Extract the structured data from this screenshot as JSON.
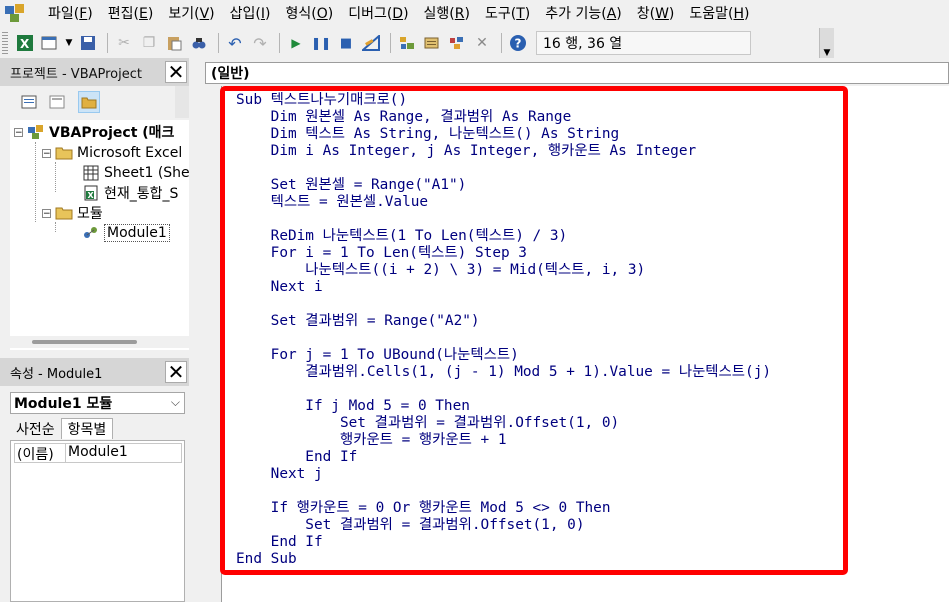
{
  "menu": {
    "items": [
      {
        "label": "파일(F)"
      },
      {
        "label": "편집(E)"
      },
      {
        "label": "보기(V)"
      },
      {
        "label": "삽입(I)"
      },
      {
        "label": "형식(O)"
      },
      {
        "label": "디버그(D)"
      },
      {
        "label": "실행(R)"
      },
      {
        "label": "도구(T)"
      },
      {
        "label": "추가 기능(A)"
      },
      {
        "label": "창(W)"
      },
      {
        "label": "도움말(H)"
      }
    ]
  },
  "toolbar": {
    "position_text": "16 행, 36 열"
  },
  "project_panel": {
    "title": "프로젝트 - VBAProject",
    "tree": {
      "root": "VBAProject (매크",
      "excel_folder": "Microsoft Excel",
      "sheet1": "Sheet1 (She",
      "workbook": "현재_통합_S",
      "modules_folder": "모듈",
      "module1": "Module1"
    }
  },
  "properties_panel": {
    "title": "속성 - Module1",
    "object_combo": "Module1 모듈",
    "tabs": [
      "사전순",
      "항목별"
    ],
    "rows": [
      {
        "key": "(이름)",
        "value": "Module1"
      }
    ]
  },
  "code_window": {
    "object_combo": "(일반)",
    "lines": [
      "Sub 텍스트나누기매크로()",
      "    Dim 원본셀 As Range, 결과범위 As Range",
      "    Dim 텍스트 As String, 나눈텍스트() As String",
      "    Dim i As Integer, j As Integer, 행카운트 As Integer",
      "",
      "    Set 원본셀 = Range(\"A1\")",
      "    텍스트 = 원본셀.Value",
      "",
      "    ReDim 나눈텍스트(1 To Len(텍스트) / 3)",
      "    For i = 1 To Len(텍스트) Step 3",
      "        나눈텍스트((i + 2) \\ 3) = Mid(텍스트, i, 3)",
      "    Next i",
      "",
      "    Set 결과범위 = Range(\"A2\")",
      "",
      "    For j = 1 To UBound(나눈텍스트)",
      "        결과범위.Cells(1, (j - 1) Mod 5 + 1).Value = 나눈텍스트(j)",
      "",
      "        If j Mod 5 = 0 Then",
      "            Set 결과범위 = 결과범위.Offset(1, 0)",
      "            행카운트 = 행카운트 + 1",
      "        End If",
      "    Next j",
      "",
      "    If 행카운트 = 0 Or 행카운트 Mod 5 <> 0 Then",
      "        Set 결과범위 = 결과범위.Offset(1, 0)",
      "    End If",
      "End Sub"
    ]
  },
  "colors": {
    "highlight_border": "#ff0000",
    "panel_title_bg": "#d6d6d6",
    "code_text": "#00007f"
  },
  "icons": [
    "vba-app-icon",
    "excel-icon",
    "insert-userform-icon",
    "save-icon",
    "cut-icon",
    "copy-icon",
    "paste-icon",
    "find-icon",
    "undo-icon",
    "redo-icon",
    "run-icon",
    "break-icon",
    "reset-icon",
    "design-mode-icon",
    "project-explorer-icon",
    "properties-icon",
    "object-browser-icon",
    "toolbox-icon",
    "help-icon"
  ]
}
